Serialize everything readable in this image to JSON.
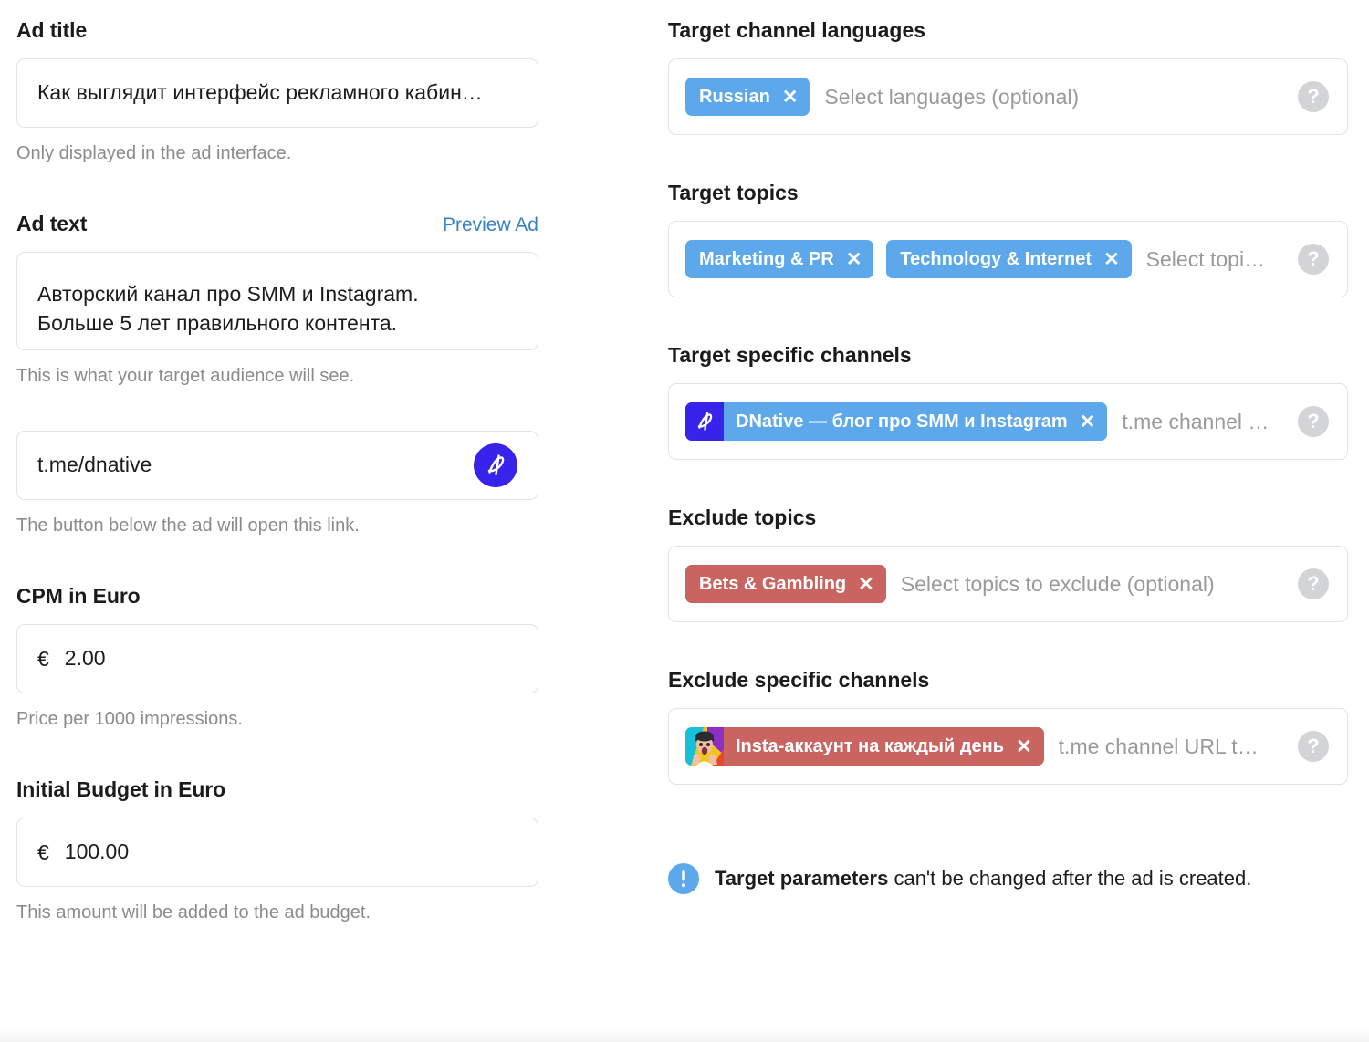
{
  "left": {
    "ad_title": {
      "label": "Ad title",
      "value": "Как выглядит интерфейс рекламного кабин…",
      "hint": "Only displayed in the ad interface."
    },
    "ad_text": {
      "label": "Ad text",
      "preview_link": "Preview Ad",
      "value_line1": "Авторский канал про SMM и Instagram.",
      "value_line2": "Больше 5 лет правильного контента.",
      "hint": "This is what your target audience will see."
    },
    "ad_link": {
      "value": "t.me/dnative",
      "hint": "The button below the ad will open this link.",
      "avatar_icon": "dnative-logo-icon"
    },
    "cpm": {
      "label": "CPM in Euro",
      "currency": "€",
      "value": "2.00",
      "hint": "Price per 1000 impressions."
    },
    "budget": {
      "label": "Initial Budget in Euro",
      "currency": "€",
      "value": "100.00",
      "hint": "This amount will be added to the ad budget."
    }
  },
  "right": {
    "languages": {
      "label": "Target channel languages",
      "placeholder": "Select languages (optional)",
      "help": "?",
      "chips": [
        {
          "label": "Russian",
          "color": "blue",
          "remove": "✕"
        }
      ]
    },
    "topics": {
      "label": "Target topics",
      "placeholder": "Select topi…",
      "help": "?",
      "chips": [
        {
          "label": "Marketing & PR",
          "color": "blue",
          "remove": "✕"
        },
        {
          "label": "Technology & Internet",
          "color": "blue",
          "remove": "✕"
        }
      ]
    },
    "channels": {
      "label": "Target specific channels",
      "placeholder": "t.me channel …",
      "help": "?",
      "chips": [
        {
          "label": "DNative — блог про SMM и Instagram",
          "color": "blue",
          "remove": "✕",
          "avatar": "dnative-avatar-icon"
        }
      ]
    },
    "exclude_topics": {
      "label": "Exclude topics",
      "placeholder": "Select topics to exclude (optional)",
      "help": "?",
      "chips": [
        {
          "label": "Bets & Gambling",
          "color": "red",
          "remove": "✕"
        }
      ]
    },
    "exclude_channels": {
      "label": "Exclude specific channels",
      "placeholder": "t.me channel URL t…",
      "help": "?",
      "chips": [
        {
          "label": "Insta-аккаунт на каждый день",
          "color": "red",
          "remove": "✕",
          "avatar": "insta-channel-avatar-icon"
        }
      ]
    },
    "notice": {
      "icon": "info-exclamation-icon",
      "bold": "Target parameters",
      "rest": " can't be changed after the ad is created."
    }
  },
  "colors": {
    "chip_blue": "#5ca8ea",
    "chip_red": "#ca6460",
    "link_blue": "#3b82c4",
    "brand_violet": "#3723ea",
    "border": "#e3e3e3",
    "hint_gray": "#8b8b8b",
    "placeholder_gray": "#9a9a9a",
    "help_gray": "#d2d4d6"
  }
}
